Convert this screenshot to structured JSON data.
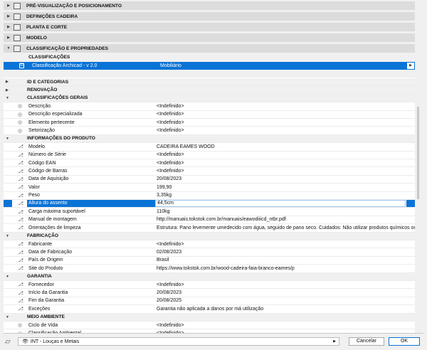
{
  "panels": [
    {
      "label": "PRÉ-VISUALIZAÇÃO E POSICIONAMENTO",
      "icon": "preview-icon",
      "open": false
    },
    {
      "label": "DEFINIÇÕES CADEIRA",
      "icon": "settings-icon",
      "open": false
    },
    {
      "label": "PLANTA E CORTE",
      "icon": "floorplan-icon",
      "open": false
    },
    {
      "label": "MODELO",
      "icon": "cube-icon",
      "open": false
    },
    {
      "label": "CLASSIFICAÇÃO E PROPRIEDADES",
      "icon": "properties-icon",
      "open": true
    }
  ],
  "classifications": {
    "label": "CLASSIFICAÇÕES",
    "selected": {
      "name": "Classificação Archicad - v 2.0",
      "value": "Mobiliário",
      "checked": "☑"
    }
  },
  "rows": [
    {
      "g": 1,
      "open": 0,
      "l": "ID E CATEGORIAS"
    },
    {
      "g": 1,
      "open": 0,
      "l": "RENOVAÇÃO"
    },
    {
      "g": 1,
      "open": 1,
      "l": "CLASSIFICAÇÕES GERAIS"
    },
    {
      "l": "Descrição",
      "v": "<Indefinido>",
      "i": "eye"
    },
    {
      "l": "Descrição especializada",
      "v": "<Indefinido>",
      "i": "eye"
    },
    {
      "l": "Elemento pertecente",
      "v": "<Indefinido>",
      "i": "eye"
    },
    {
      "l": "Setorização",
      "v": "<Indefinido>",
      "i": "eye"
    },
    {
      "g": 1,
      "open": 1,
      "l": "INFORMAÇÕES DO PRODUTO"
    },
    {
      "l": "Modelo",
      "v": "CADEIRA EAMES WOOD",
      "i": "link"
    },
    {
      "l": "Número de Série",
      "v": "<Indefinido>",
      "i": "link"
    },
    {
      "l": "Código EAN",
      "v": "<Indefinido>",
      "i": "link"
    },
    {
      "l": "Código de Barras",
      "v": "<Indefinido>",
      "i": "link"
    },
    {
      "l": "Data de Aquisição",
      "v": "20/08/2023",
      "i": "link"
    },
    {
      "l": "Valor",
      "v": " 199,90",
      "i": "link"
    },
    {
      "l": "Peso",
      "v": "3,35kg",
      "i": "link"
    },
    {
      "l": "Altura do assento",
      "v": "44,5cm",
      "i": "link",
      "active": 1
    },
    {
      "l": "Carga máxima suportável",
      "v": "110kg",
      "i": "link"
    },
    {
      "l": "Manual de montagem",
      "v": "http://manuais.tokstok.com.br/manuais/eawodiiicd_ntbr.pdf",
      "i": "link"
    },
    {
      "l": "Orientações de limpeza",
      "v": "Estrutura: Pano levemente umedecido com água, seguido de pano seco.  Cuidados: Não utilizar produtos químicos ou ab...",
      "i": "link"
    },
    {
      "g": 1,
      "open": 1,
      "l": "FABRICAÇÃO"
    },
    {
      "l": "Fabricante",
      "v": "<Indefinido>",
      "i": "link"
    },
    {
      "l": "Data de Fabricação",
      "v": "02/08/2023",
      "i": "link"
    },
    {
      "l": "País de Origem",
      "v": "Brasil",
      "i": "link"
    },
    {
      "l": "Site do Produto",
      "v": "https://www.tokstok.com.br/wood-cadeira-faia-branco-eames/p",
      "i": "link"
    },
    {
      "g": 1,
      "open": 1,
      "l": "GARANTIA"
    },
    {
      "l": "Fornecedor",
      "v": "<Indefinido>",
      "i": "link"
    },
    {
      "l": "Início da Garantia",
      "v": "20/08/2023",
      "i": "link"
    },
    {
      "l": "Fim da Garantia",
      "v": "20/08/2025",
      "i": "link"
    },
    {
      "l": "Exceções",
      "v": "Garantia não aplicada a danos por má utilização",
      "i": "link"
    },
    {
      "g": 1,
      "open": 1,
      "l": "MEIO AMBIENTE"
    },
    {
      "l": "Ciclo de Vida",
      "v": "<Indefinido>",
      "i": "eye"
    },
    {
      "l": "Classificação Ambiental",
      "v": "<Indefinido>",
      "i": "eye"
    }
  ],
  "footer": {
    "layer": "INT - Louças e Metais",
    "cancel": "Cancelar",
    "ok": "OK"
  },
  "colors": {
    "accent": "#0a73d6"
  }
}
